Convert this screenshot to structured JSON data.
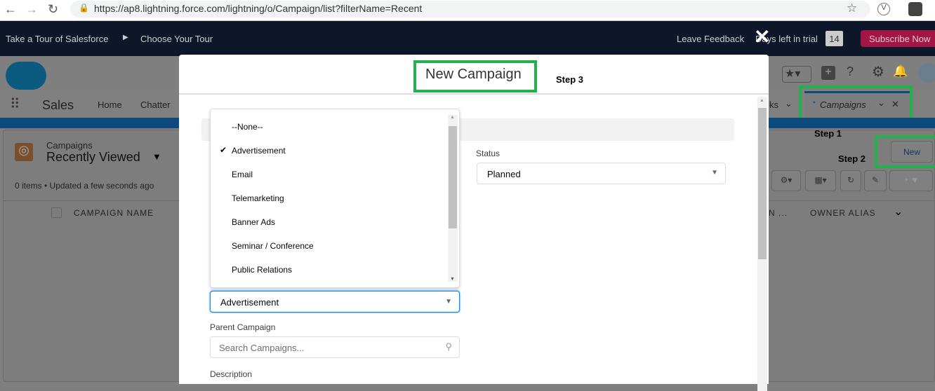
{
  "browser": {
    "url": "https://ap8.lightning.force.com/lightning/o/Campaign/list?filterName=Recent"
  },
  "tour": {
    "take_tour": "Take a Tour of Salesforce",
    "choose_tour": "Choose Your Tour",
    "feedback": "Leave Feedback",
    "trial": "Days left in trial",
    "days": "14",
    "subscribe": "Subscribe Now"
  },
  "nav": {
    "app": "Sales",
    "items": [
      "Home",
      "Chatter"
    ],
    "partial": "ks",
    "tab": "Campaigns",
    "tab_mark": "*"
  },
  "list": {
    "object": "Campaigns",
    "view": "Recently Viewed",
    "status": "0 items • Updated a few seconds ago",
    "col1": "CAMPAIGN NAME",
    "col2": "N ...",
    "col3": "OWNER ALIAS",
    "new": "New"
  },
  "annotations": {
    "step1": "Step 1",
    "step2": "Step 2",
    "step3": "Step 3"
  },
  "modal": {
    "title": "New Campaign",
    "status_label": "Status",
    "status_value": "Planned",
    "type_value": "Advertisement",
    "parent_label": "Parent Campaign",
    "parent_placeholder": "Search Campaigns...",
    "description_label": "Description"
  },
  "dropdown": {
    "options": [
      "--None--",
      "Advertisement",
      "Email",
      "Telemarketing",
      "Banner Ads",
      "Seminar / Conference",
      "Public Relations"
    ],
    "selected": "Advertisement"
  },
  "colors": {
    "brand": "#0070d2",
    "subscribe": "#c23934",
    "highlight": "#22b14c"
  }
}
